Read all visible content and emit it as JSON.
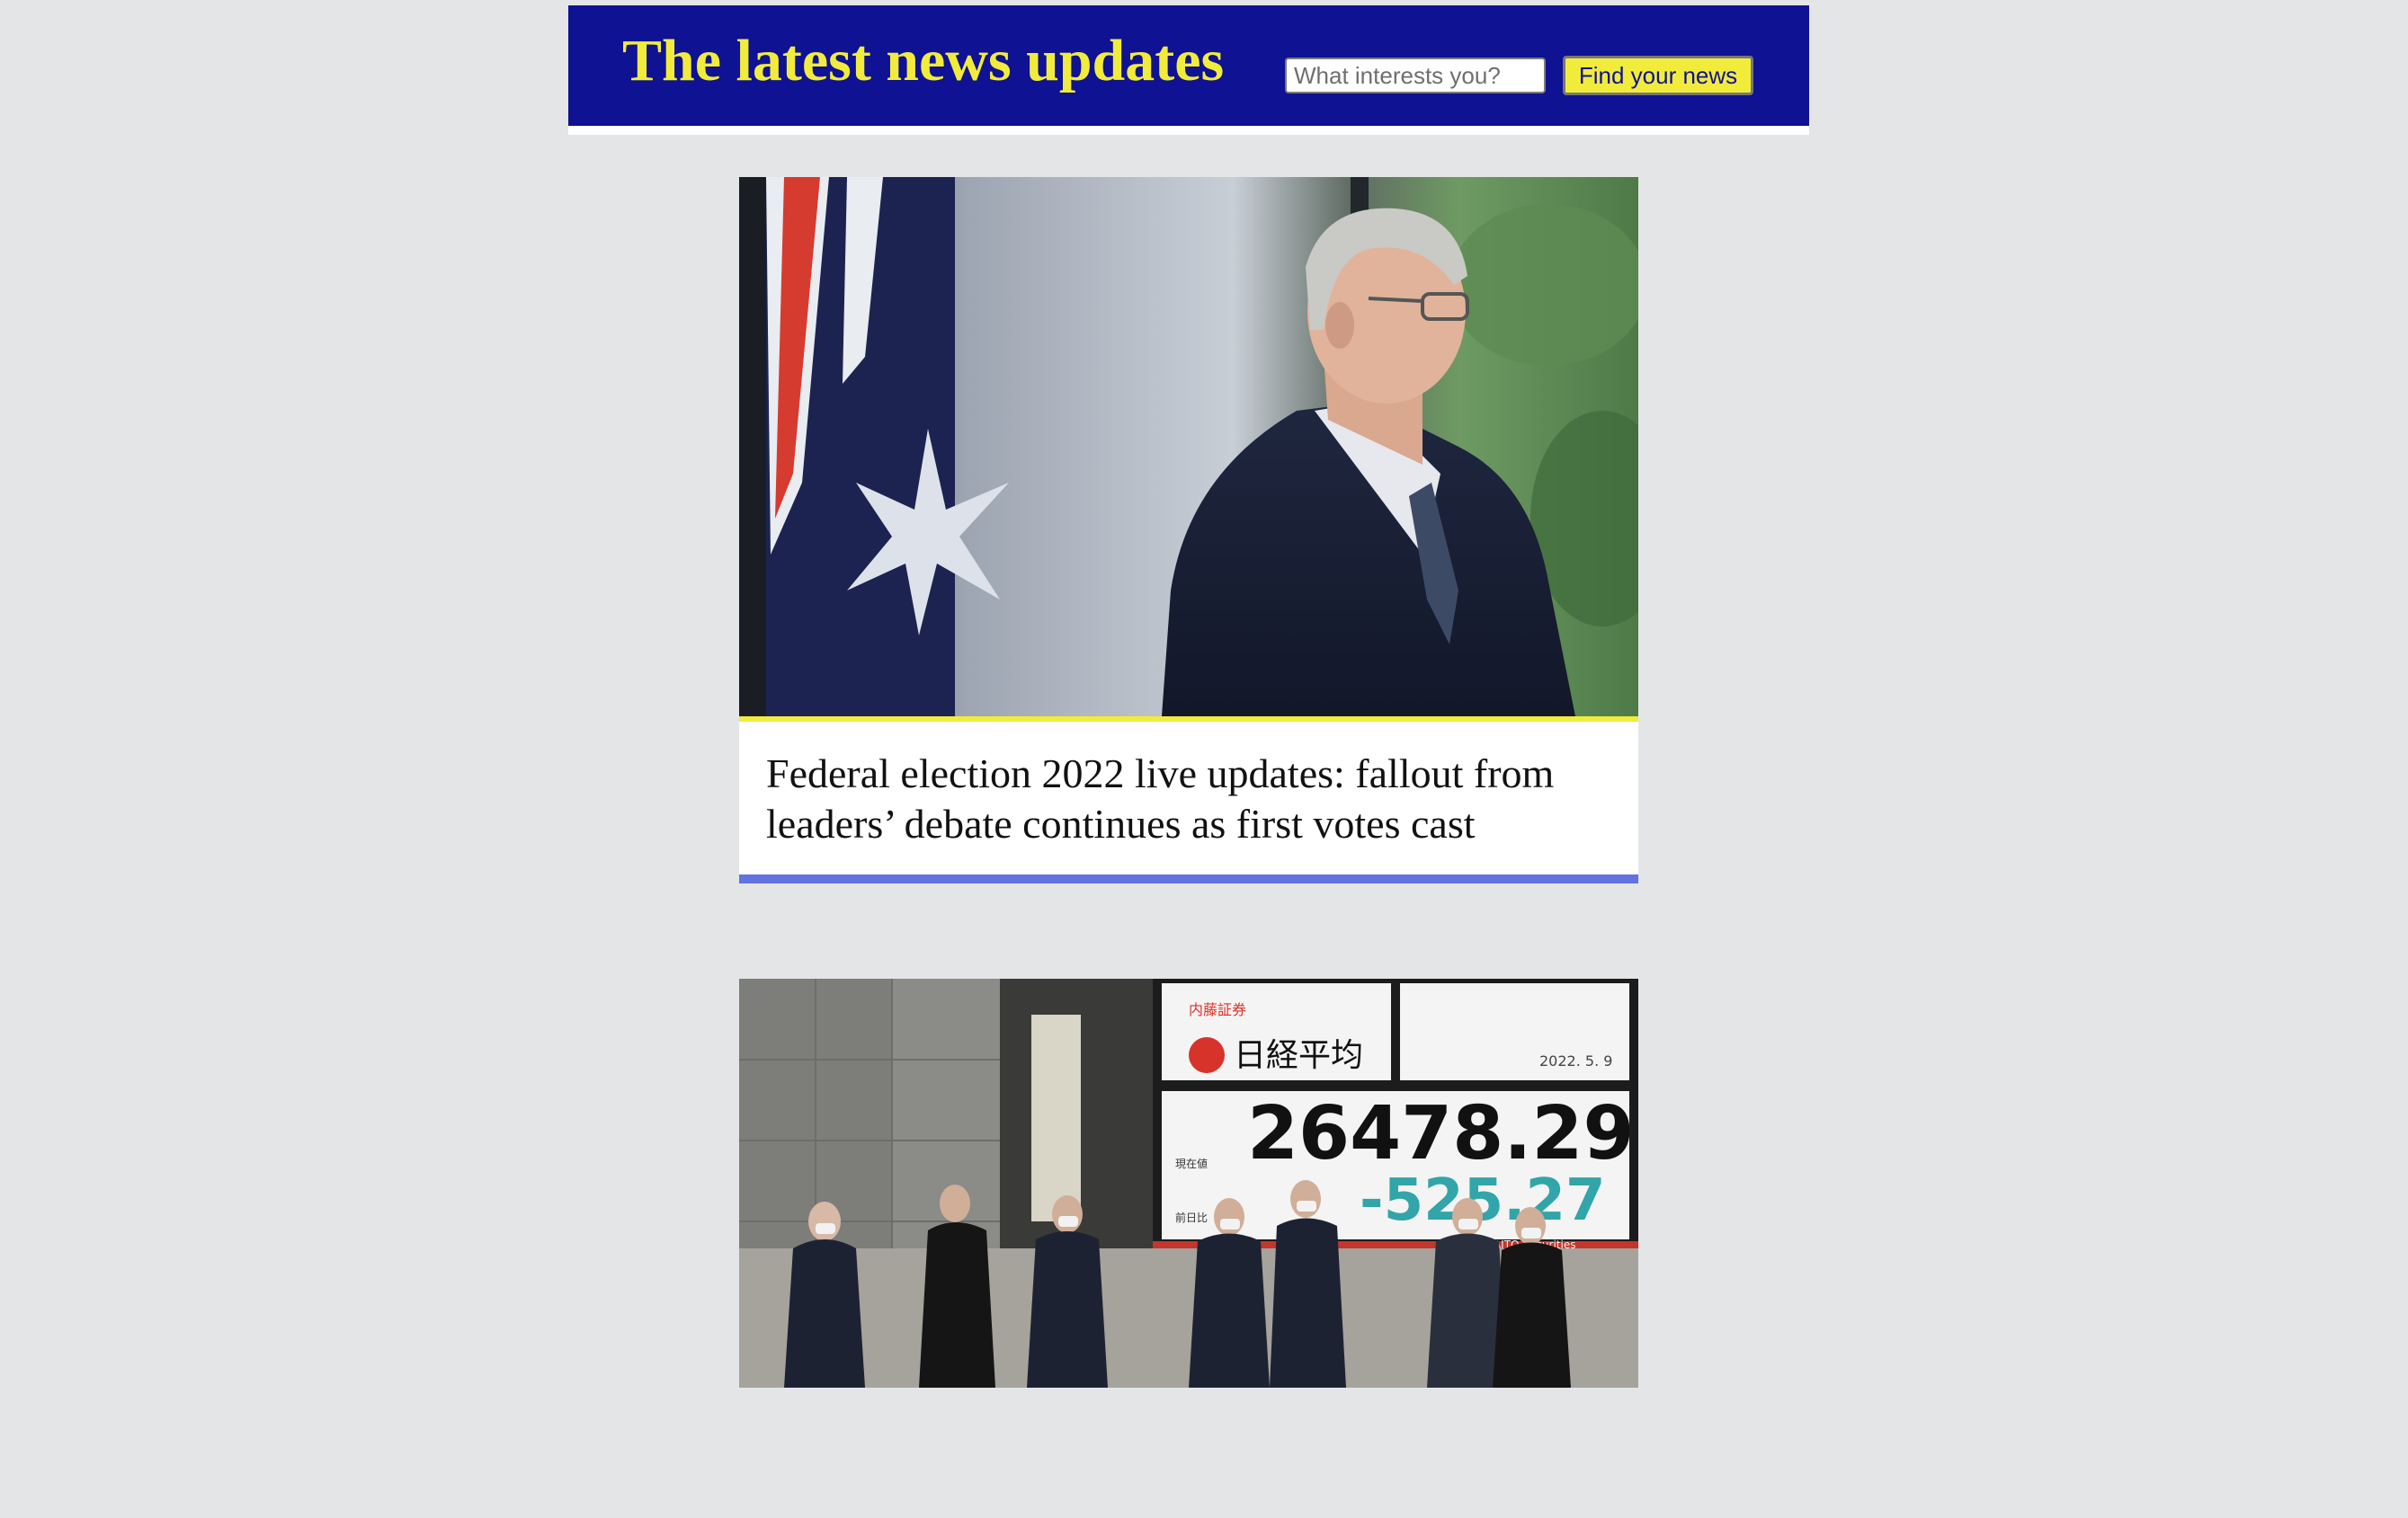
{
  "header": {
    "title": "The latest news updates",
    "search": {
      "placeholder": "What interests you?",
      "value": ""
    },
    "find_button_label": "Find your news"
  },
  "articles": [
    {
      "title": "Federal election 2022 live updates: fallout from leaders’ debate continues as first votes cast",
      "image": "photo: man in suit standing beside Australian flag"
    },
    {
      "image": "photo: commuters in masks walking past stock index board",
      "board": {
        "brand": "内藤証券",
        "index_name": "日経平均",
        "date": "2022. 5. 9",
        "current_label": "現在値",
        "prev_label": "前日比",
        "value": "26478.29",
        "change": "-525.27",
        "footer": "NAITO Securities"
      }
    }
  ]
}
